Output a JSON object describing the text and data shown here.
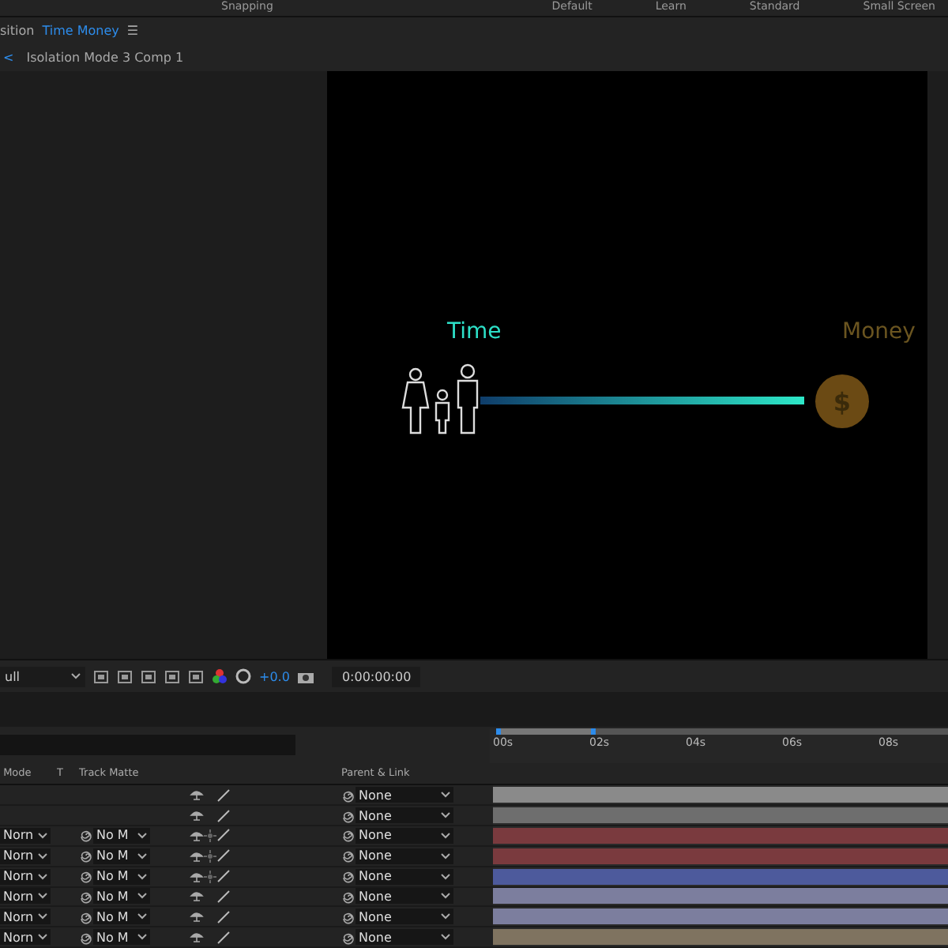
{
  "top_bar": {
    "tools": [
      "Snapping"
    ],
    "workspaces": [
      "Default",
      "Learn",
      "Standard",
      "Small Screen"
    ]
  },
  "viewer_tab": {
    "prefix": "sition",
    "name": "Time Money",
    "menu": "☰"
  },
  "breadcrumb": {
    "back": "<",
    "label": "Isolation Mode 3 Comp 1"
  },
  "composition": {
    "left_label": "Time",
    "right_label": "Money",
    "coin_symbol": "$"
  },
  "viewer_toolbar": {
    "resolution": "ull",
    "exposure": "+0.0",
    "timecode": "0:00:00:00"
  },
  "timeline": {
    "ruler": [
      "00s",
      "02s",
      "04s",
      "06s",
      "08s"
    ],
    "work_area": {
      "level": 0.2
    },
    "columns": {
      "mode": "Mode",
      "t": "T",
      "track_matte": "Track Matte",
      "parent": "Parent & Link"
    },
    "layers": [
      {
        "kind": "null",
        "parent": "None",
        "color": "#8a8a8a"
      },
      {
        "kind": "null",
        "parent": "None",
        "color": "#6e6e6e"
      },
      {
        "kind": "layer",
        "mode": "Norn",
        "matte": "No M",
        "parent": "None",
        "collapse": true,
        "color": "#7a3a3e"
      },
      {
        "kind": "layer",
        "mode": "Norn",
        "matte": "No M",
        "parent": "None",
        "collapse": true,
        "color": "#7a3a3e"
      },
      {
        "kind": "layer",
        "mode": "Norn",
        "matte": "No M",
        "parent": "None",
        "collapse": true,
        "color": "#4d5a9c"
      },
      {
        "kind": "layer",
        "mode": "Norn",
        "matte": "No M",
        "parent": "None",
        "collapse": false,
        "color": "#7c7e9e"
      },
      {
        "kind": "layer",
        "mode": "Norn",
        "matte": "No M",
        "parent": "None",
        "collapse": false,
        "color": "#7c7e9e"
      },
      {
        "kind": "layer",
        "mode": "Norn",
        "matte": "No M",
        "parent": "None",
        "collapse": false,
        "color": "#7f7360"
      }
    ]
  }
}
